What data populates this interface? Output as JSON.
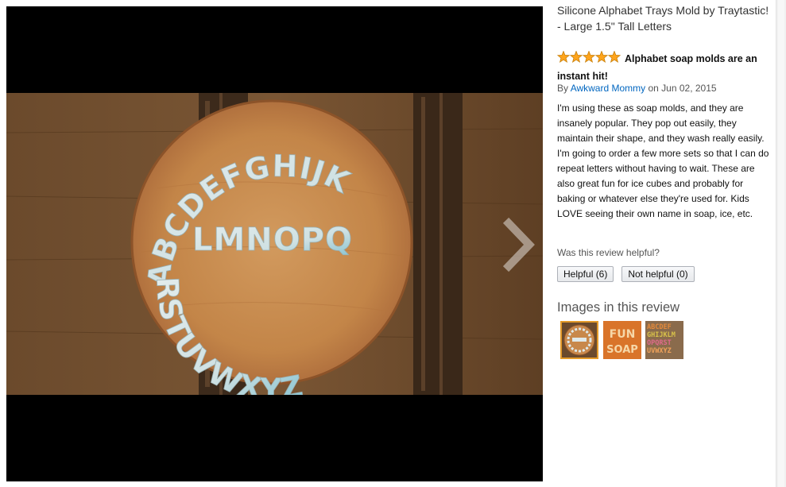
{
  "product": {
    "title_line1": "Silicone Alphabet Trays Mold by Traytastic!",
    "title_line2": "- Large 1.5\" Tall Letters"
  },
  "review": {
    "rating": 5,
    "rating_max": 5,
    "title": "Alphabet soap molds are an instant hit!",
    "by_prefix": "By",
    "author": "Awkward Mommy",
    "date": "on Jun 02, 2015",
    "body": "I'm using these as soap molds, and they are insanely popular. They pop out easily, they maintain their shape, and they wash really easily. I'm going to order a few more sets so that I can do repeat letters without having to wait. These are also great fun for ice cubes and probably for baking or whatever else they're used for. Kids LOVE seeing their own name in soap, ice, etc."
  },
  "helpful": {
    "question": "Was this review helpful?",
    "helpful_label": "Helpful (6)",
    "not_helpful_label": "Not helpful (0)"
  },
  "images_section": {
    "heading": "Images in this review",
    "selected_index": 0,
    "thumbnails": [
      {
        "icon": "abc-circle-thumbnail"
      },
      {
        "icon": "fun-soap-thumbnail",
        "text": "FUN SOAP"
      },
      {
        "icon": "alphabet-grid-thumbnail",
        "text": "ABCDEFGHIJKLMNOPQRSTUVWXYZ"
      }
    ]
  },
  "photo": {
    "arc_top": "ABCDEFGHIJK",
    "middle": "LMNOPQ",
    "arc_bottom": "RSTUVWXYZ"
  },
  "colors": {
    "link": "#0066c0",
    "star": "#ffa41c",
    "selected_border": "#e49b2a",
    "letter_fill": "#dfe9ea",
    "letter_accent": "#7cc0cf"
  }
}
